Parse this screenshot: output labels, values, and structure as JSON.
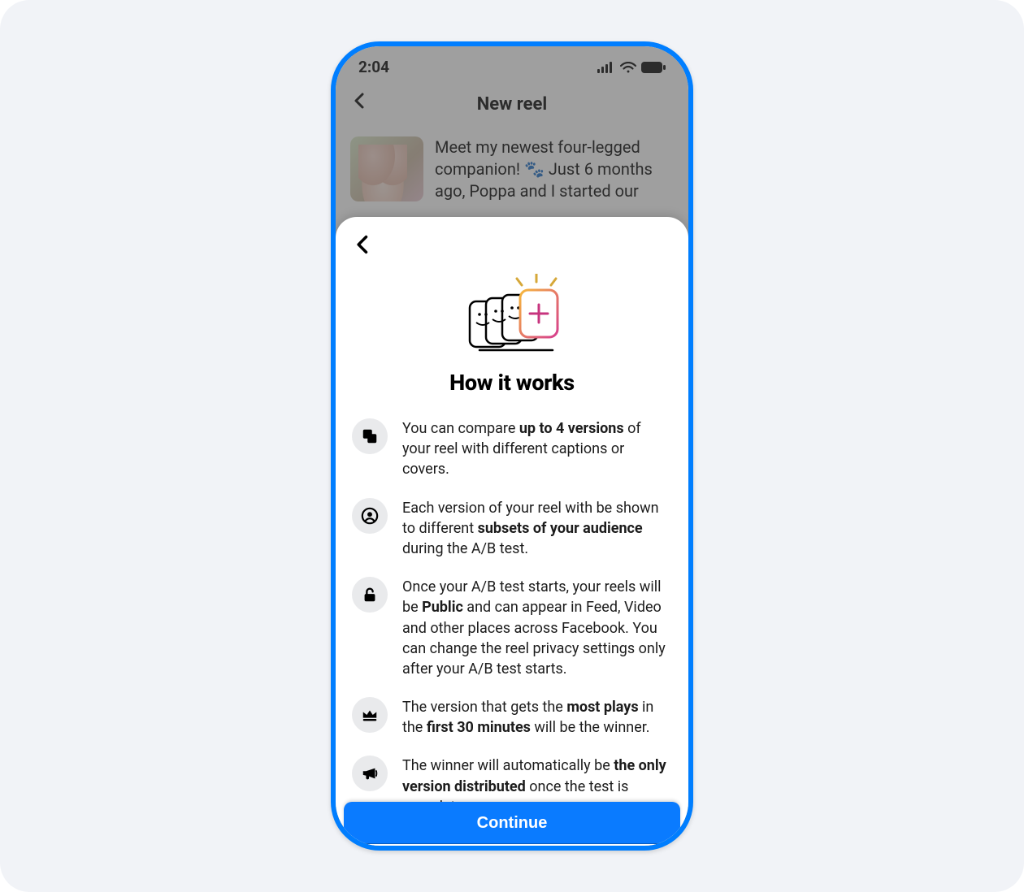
{
  "status": {
    "time": "2:04"
  },
  "bg": {
    "title": "New reel",
    "caption_line1": "Meet my newest four-legged",
    "caption_line2": "companion! 🐾 Just 6 months",
    "caption_line3": "ago, Poppa and I started our"
  },
  "sheet": {
    "title": "How it works",
    "continue_label": "Continue",
    "items": [
      {
        "icon": "stack",
        "pre": "You can compare ",
        "b1": "up to 4 versions",
        "post": " of your reel with different captions or covers."
      },
      {
        "icon": "person",
        "pre": "Each version of your reel with be shown to different ",
        "b1": "subsets of your audience",
        "post": " during the A/B test."
      },
      {
        "icon": "lock",
        "pre": "Once your A/B test starts, your reels will be ",
        "b1": "Public",
        "post": " and can appear in Feed, Video and other places across Facebook. You can change the reel privacy settings only after your A/B test starts."
      },
      {
        "icon": "crown",
        "pre": "The version that gets the ",
        "b1": "most plays",
        "mid": " in the ",
        "b2": "first 30 minutes",
        "post": " will be the winner."
      },
      {
        "icon": "megaphone",
        "pre": "The winner will automatically be ",
        "b1": "the only version distributed",
        "post": " once the test is complete."
      }
    ]
  }
}
